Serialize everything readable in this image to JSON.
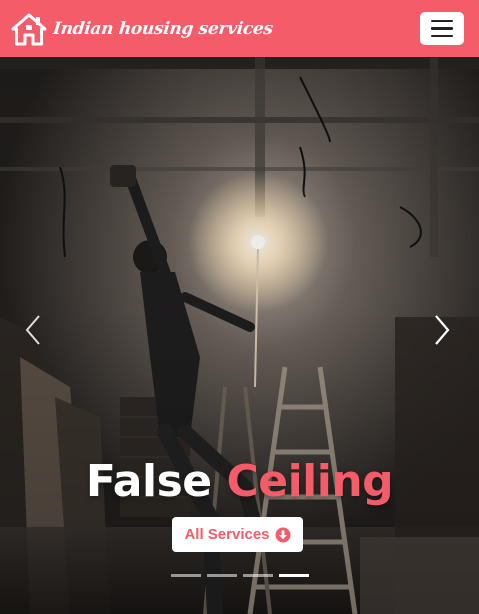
{
  "navbar": {
    "brand_text": "Indian housing services",
    "brand_icon": "home-icon",
    "toggler_icon": "hamburger-menu-icon"
  },
  "carousel": {
    "slide_image": "worker on ladder installing false ceiling",
    "caption_white": "False",
    "caption_accent": "Ceiling",
    "button_label": "All Services",
    "button_icon": "arrow-circle-down-icon",
    "prev_icon": "chevron-left-icon",
    "next_icon": "chevron-right-icon",
    "indicator_count": 4,
    "active_indicator": 4
  },
  "colors": {
    "brand": "#f35c68",
    "white": "#ffffff",
    "dark": "#222222"
  }
}
